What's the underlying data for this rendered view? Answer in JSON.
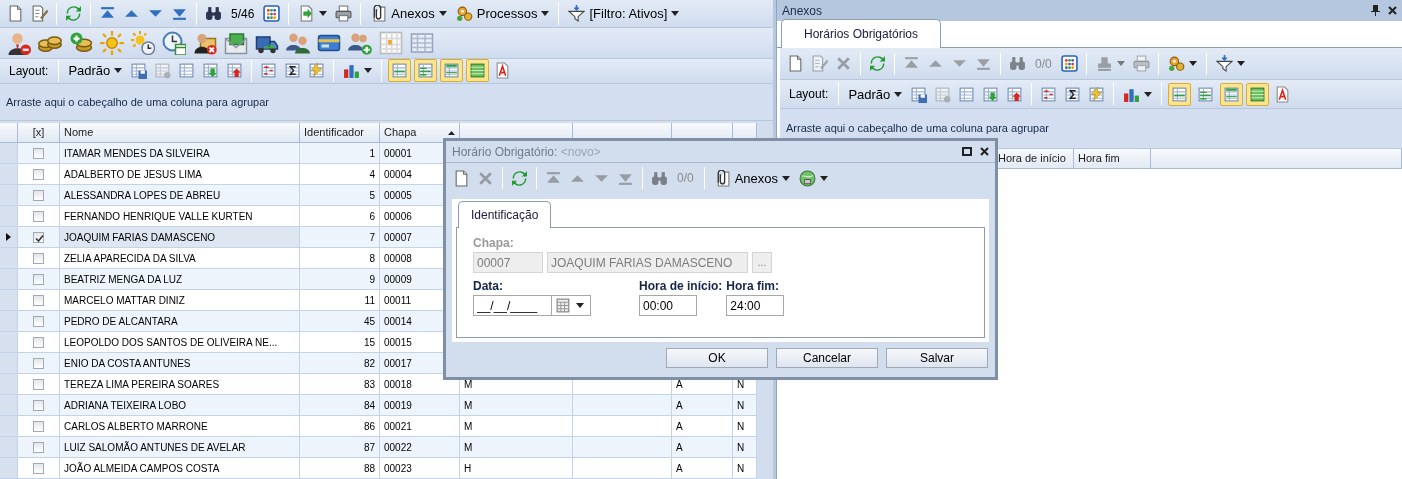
{
  "main": {
    "toolbar": [
      {
        "kind": "new"
      },
      {
        "kind": "edit"
      },
      {
        "kind": "sep"
      },
      {
        "kind": "refresh"
      },
      {
        "kind": "sep"
      },
      {
        "kind": "first"
      },
      {
        "kind": "prev"
      },
      {
        "kind": "next"
      },
      {
        "kind": "last"
      },
      {
        "kind": "sep"
      },
      {
        "kind": "find"
      },
      {
        "kind": "counter",
        "text": "5/46"
      },
      {
        "kind": "grid"
      },
      {
        "kind": "sep"
      },
      {
        "kind": "export",
        "caret": true
      },
      {
        "kind": "print"
      },
      {
        "kind": "sep"
      },
      {
        "kind": "attach",
        "text": "Anexos",
        "caret": true
      },
      {
        "kind": "process",
        "text": "Processos",
        "caret": true
      },
      {
        "kind": "sep"
      },
      {
        "kind": "filter",
        "text": "[Filtro: Ativos]",
        "caret": true
      }
    ],
    "toolbar_2": [
      {
        "kind": "personremove"
      },
      {
        "kind": "coins"
      },
      {
        "kind": "coinsadd"
      },
      {
        "kind": "sun"
      },
      {
        "kind": "sunclock"
      },
      {
        "kind": "clockcal"
      },
      {
        "kind": "personfolder"
      },
      {
        "kind": "mail"
      },
      {
        "kind": "truck"
      },
      {
        "kind": "people"
      },
      {
        "kind": "card"
      },
      {
        "kind": "peopleadd"
      },
      {
        "kind": "calendar"
      },
      {
        "kind": "sheet"
      }
    ],
    "layout_toolbar": [
      {
        "kind": "label",
        "text": "Layout:"
      },
      {
        "kind": "sep"
      },
      {
        "kind": "layouts",
        "text": "Padrão",
        "caret": true
      },
      {
        "kind": "savelayout"
      },
      {
        "kind": "dellayout",
        "disabled": true
      },
      {
        "kind": "table"
      },
      {
        "kind": "import"
      },
      {
        "kind": "exportred"
      },
      {
        "kind": "sep"
      },
      {
        "kind": "columns"
      },
      {
        "kind": "sum"
      },
      {
        "kind": "format"
      },
      {
        "kind": "sep"
      },
      {
        "kind": "chart",
        "caret": true
      },
      {
        "kind": "sep"
      },
      {
        "kind": "togglea",
        "pressed": true
      },
      {
        "kind": "toggleb",
        "pressed": true
      },
      {
        "kind": "togglec",
        "pressed": true
      },
      {
        "kind": "toggled",
        "pressed": true
      },
      {
        "kind": "font"
      }
    ],
    "group_panel": "Arraste aqui o cabeçalho de uma coluna para agrupar",
    "table": {
      "columns": [
        {
          "label": "[x]"
        },
        {
          "label": "Nome"
        },
        {
          "label": "Identificador"
        },
        {
          "label": "Chapa",
          "sorted": true
        }
      ],
      "rows": [
        {
          "current": false,
          "checked": false,
          "nome": "ITAMAR MENDES DA SILVEIRA",
          "identificador": "1",
          "chapa": "00001"
        },
        {
          "current": false,
          "checked": false,
          "nome": "ADALBERTO DE JESUS LIMA",
          "identificador": "4",
          "chapa": "00004"
        },
        {
          "current": false,
          "checked": false,
          "nome": "ALESSANDRA LOPES DE ABREU",
          "identificador": "5",
          "chapa": "00005"
        },
        {
          "current": false,
          "checked": false,
          "nome": "FERNANDO HENRIQUE VALLE KURTEN",
          "identificador": "6",
          "chapa": "00006"
        },
        {
          "current": true,
          "checked": true,
          "nome": "JOAQUIM FARIAS DAMASCENO",
          "identificador": "7",
          "chapa": "00007"
        },
        {
          "current": false,
          "checked": false,
          "nome": "ZELIA APARECIDA DA SILVA",
          "identificador": "8",
          "chapa": "00008"
        },
        {
          "current": false,
          "checked": false,
          "nome": "BEATRIZ MENGA DA LUZ",
          "identificador": "9",
          "chapa": "00009"
        },
        {
          "current": false,
          "checked": false,
          "nome": "MARCELO MATTAR DINIZ",
          "identificador": "11",
          "chapa": "00011"
        },
        {
          "current": false,
          "checked": false,
          "nome": "PEDRO DE ALCANTARA",
          "identificador": "45",
          "chapa": "00014"
        },
        {
          "current": false,
          "checked": false,
          "nome": "LEOPOLDO DOS SANTOS DE OLIVEIRA NE...",
          "identificador": "15",
          "chapa": "00015"
        },
        {
          "current": false,
          "checked": false,
          "nome": "ENIO DA COSTA ANTUNES",
          "identificador": "82",
          "chapa": "00017"
        },
        {
          "current": false,
          "checked": false,
          "nome": "TEREZA LIMA PEREIRA SOARES",
          "identificador": "83",
          "chapa": "00018",
          "column_5": "M",
          "column_7": "A",
          "column_8": "N"
        },
        {
          "current": false,
          "checked": false,
          "nome": "ADRIANA TEIXEIRA LOBO",
          "identificador": "84",
          "chapa": "00019",
          "column_5": "M",
          "column_7": "A",
          "column_8": "N"
        },
        {
          "current": false,
          "checked": false,
          "nome": "CARLOS ALBERTO MARRONE",
          "identificador": "86",
          "chapa": "00021",
          "column_5": "M",
          "column_7": "A",
          "column_8": "N"
        },
        {
          "current": false,
          "checked": false,
          "nome": "LUIZ SALOMÃO ANTUNES DE AVELAR",
          "identificador": "87",
          "chapa": "00022",
          "column_5": "M",
          "column_7": "A",
          "column_8": "N"
        },
        {
          "current": false,
          "checked": false,
          "nome": "JOÃO ALMEIDA CAMPOS COSTA",
          "identificador": "88",
          "chapa": "00023",
          "column_5": "H",
          "column_7": "A",
          "column_8": "N"
        }
      ]
    }
  },
  "attachments_panel": {
    "title": "Anexos",
    "tabs": [
      {
        "label": "Horários Obrigatórios",
        "selected": true
      }
    ],
    "toolbar": [
      {
        "kind": "new"
      },
      {
        "kind": "edit",
        "disabled": true
      },
      {
        "kind": "delete",
        "disabled": true
      },
      {
        "kind": "sep"
      },
      {
        "kind": "refresh"
      },
      {
        "kind": "sep"
      },
      {
        "kind": "first",
        "disabled": true
      },
      {
        "kind": "prev",
        "disabled": true
      },
      {
        "kind": "next",
        "disabled": true
      },
      {
        "kind": "last",
        "disabled": true
      },
      {
        "kind": "sep"
      },
      {
        "kind": "find",
        "disabled": true
      },
      {
        "kind": "counter",
        "text": "0/0",
        "disabled": true
      },
      {
        "kind": "grid"
      },
      {
        "kind": "sep"
      },
      {
        "kind": "stamp",
        "caret": true,
        "disabled": true
      },
      {
        "kind": "print",
        "disabled": true
      },
      {
        "kind": "sep"
      },
      {
        "kind": "process",
        "caret": true
      },
      {
        "kind": "sep"
      },
      {
        "kind": "filter",
        "caret": true
      }
    ],
    "layout_toolbar": [
      {
        "kind": "label",
        "text": "Layout:"
      },
      {
        "kind": "sep"
      },
      {
        "kind": "layouts",
        "text": "Padrão",
        "caret": true
      },
      {
        "kind": "savelayout"
      },
      {
        "kind": "dellayout",
        "disabled": true
      },
      {
        "kind": "table"
      },
      {
        "kind": "import"
      },
      {
        "kind": "exportred"
      },
      {
        "kind": "sep"
      },
      {
        "kind": "columns"
      },
      {
        "kind": "sum"
      },
      {
        "kind": "format"
      },
      {
        "kind": "sep"
      },
      {
        "kind": "chart",
        "caret": true
      },
      {
        "kind": "sep"
      },
      {
        "kind": "togglea",
        "pressed": true
      },
      {
        "kind": "toggleb",
        "pressed": false
      },
      {
        "kind": "togglec",
        "pressed": true
      },
      {
        "kind": "toggled",
        "pressed": true
      },
      {
        "kind": "font"
      }
    ],
    "group_panel": "Arraste aqui o cabeçalho de uma coluna para agrupar",
    "table": {
      "columns": [
        {
          "label": "Hora de início"
        },
        {
          "label": "Hora fim"
        }
      ]
    }
  },
  "dialog": {
    "title": "Horário Obrigatório:",
    "record": "<novo>",
    "toolbar": [
      {
        "kind": "new"
      },
      {
        "kind": "delete",
        "disabled": true
      },
      {
        "kind": "sep"
      },
      {
        "kind": "refresh"
      },
      {
        "kind": "sep"
      },
      {
        "kind": "first",
        "disabled": true
      },
      {
        "kind": "prev",
        "disabled": true
      },
      {
        "kind": "next",
        "disabled": true
      },
      {
        "kind": "last",
        "disabled": true
      },
      {
        "kind": "sep"
      },
      {
        "kind": "find",
        "disabled": true
      },
      {
        "kind": "counter",
        "text": "0/0",
        "disabled": true
      },
      {
        "kind": "sep"
      },
      {
        "kind": "attach",
        "text": "Anexos",
        "caret": true
      },
      {
        "kind": "globe",
        "caret": true
      }
    ],
    "tabs": [
      {
        "label": "Identificação",
        "selected": true
      }
    ],
    "chapa": {
      "label": "Chapa:",
      "disabled": true,
      "code": "00007",
      "name": "JOAQUIM FARIAS DAMASCENO",
      "lookup": "..."
    },
    "data": {
      "label": "Data:",
      "value": "__/__/____"
    },
    "hora_inicio": {
      "label": "Hora de início:",
      "value": "00:00"
    },
    "hora_fim": {
      "label": "Hora fim:",
      "value": "24:00"
    },
    "buttons": [
      "OK",
      "Cancelar",
      "Salvar"
    ]
  }
}
